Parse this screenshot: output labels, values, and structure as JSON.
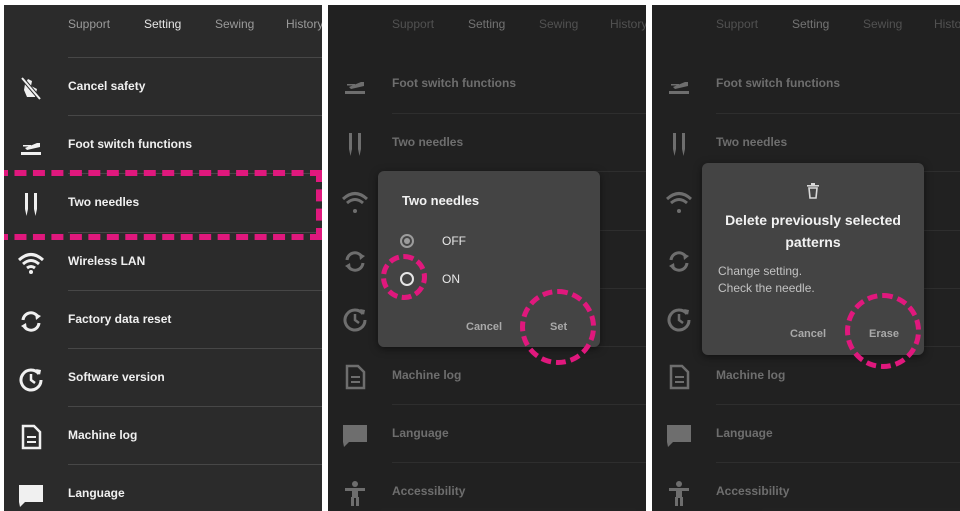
{
  "tabs": {
    "support": "Support",
    "setting": "Setting",
    "sewing": "Sewing",
    "history": "History"
  },
  "menu": {
    "cancel_safety": "Cancel safety",
    "foot_switch": "Foot switch functions",
    "two_needles": "Two needles",
    "wireless_lan": "Wireless LAN",
    "factory_reset": "Factory data reset",
    "software_version": "Software version",
    "machine_log": "Machine log",
    "language": "Language",
    "accessibility": "Accessibility"
  },
  "dialog_two_needles": {
    "title": "Two needles",
    "option_off": "OFF",
    "option_on": "ON",
    "selected": "OFF",
    "cancel_label": "Cancel",
    "set_label": "Set"
  },
  "dialog_delete": {
    "icon": "trash-icon",
    "title_line1": "Delete previously selected",
    "title_line2": "patterns",
    "body_line1": "Change setting.",
    "body_line2": "Check the needle.",
    "cancel_label": "Cancel",
    "erase_label": "Erase"
  },
  "colors": {
    "panel_bg": "#2b2b2b",
    "dialog_bg": "#444444",
    "highlight": "#e0187d"
  }
}
